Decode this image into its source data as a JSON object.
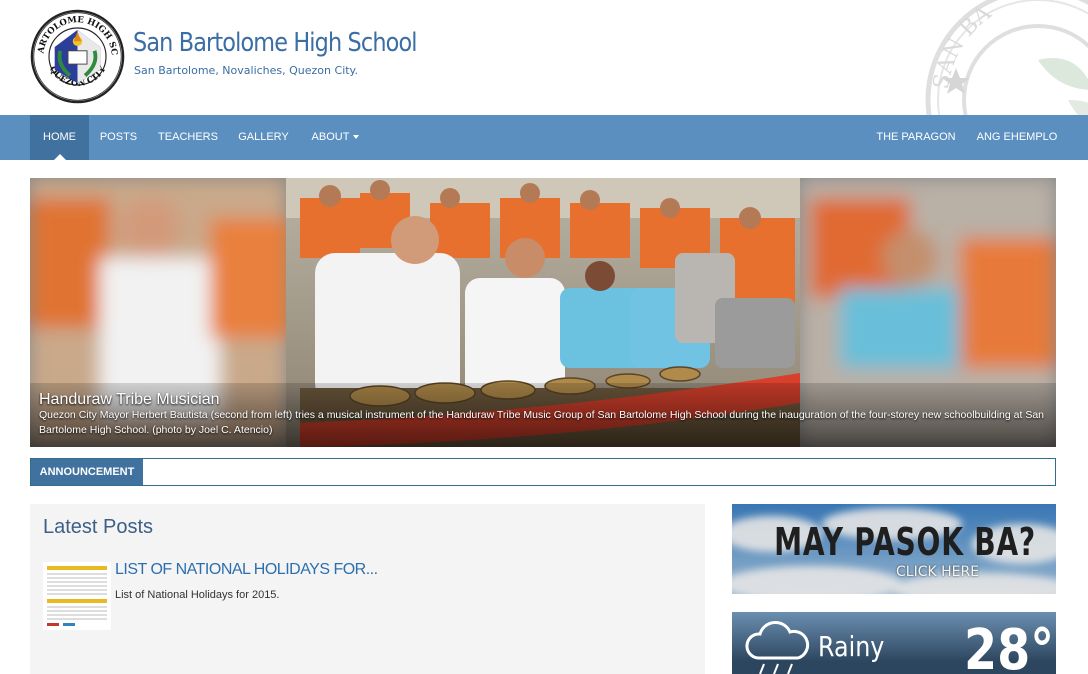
{
  "header": {
    "title": "San Bartolome High School",
    "subtitle": "San Bartolome, Novaliches, Quezon City.",
    "seal_top_text": "SAN BARTOLOME HIGH SCHOOL",
    "seal_bottom_text": "QUEZON CITY",
    "watermark_text": "SAN BA"
  },
  "nav": {
    "left": [
      {
        "label": "Home",
        "active": true
      },
      {
        "label": "Posts"
      },
      {
        "label": "Teachers"
      },
      {
        "label": "Gallery"
      },
      {
        "label": "About",
        "dropdown": true
      }
    ],
    "right": [
      {
        "label": "The Paragon"
      },
      {
        "label": "Ang Ehemplo"
      }
    ]
  },
  "slider": {
    "title": "Handuraw Tribe Musician",
    "caption": "Quezon City Mayor Herbert Bautista (second from left) tries a musical instrument of the Handuraw Tribe Music Group of San Bartolome High School during the inauguration of the four-storey new schoolbuilding at San Bartolome High School. (photo by Joel C. Atencio)"
  },
  "announcement": {
    "label": "ANNOUNCEMENT",
    "text": ""
  },
  "latest_posts": {
    "heading": "Latest Posts",
    "items": [
      {
        "title": "LIST OF NATIONAL HOLIDAYS FOR...",
        "excerpt": "List of National Holidays for 2015."
      }
    ]
  },
  "sidebar": {
    "banner1": {
      "title": "MAY PASOK BA?",
      "link": "CLICK HERE"
    },
    "banner2": {
      "condition": "Rainy",
      "temperature": "28°"
    }
  },
  "colors": {
    "nav": "#5b8fc0",
    "nav_active": "#41719e",
    "title_blue": "#3a6ea5",
    "link_blue": "#2d6fae"
  }
}
